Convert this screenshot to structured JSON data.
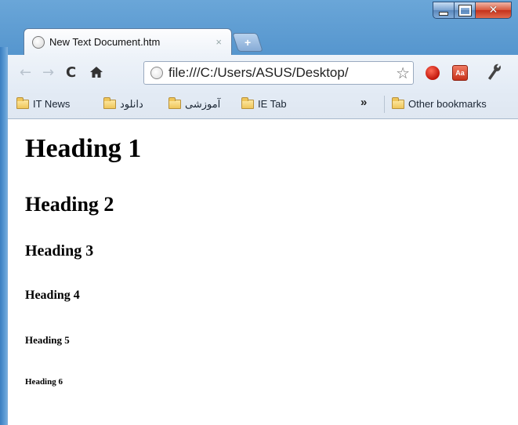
{
  "window": {
    "accent": "#3c7fbf"
  },
  "tabs": [
    {
      "title": "New Text Document.htm",
      "close": "×",
      "active": true
    }
  ],
  "new_tab_symbol": "+",
  "toolbar": {
    "back": "←",
    "forward": "→",
    "reload": "C",
    "home": "⌂",
    "address": "file:///C:/Users/ASUS/Desktop/",
    "star": "☆",
    "ext_dictionary_label": "Aa",
    "wrench": "🔧"
  },
  "bookmarks": {
    "items": [
      {
        "label": "IT News"
      },
      {
        "label": "دانلود"
      },
      {
        "label": "آموزشی"
      },
      {
        "label": "IE Tab"
      }
    ],
    "overflow": "»",
    "other": "Other bookmarks"
  },
  "content": {
    "h1": "Heading 1",
    "h2": "Heading 2",
    "h3": "Heading 3",
    "h4": "Heading 4",
    "h5": "Heading 5",
    "h6": "Heading 6"
  }
}
